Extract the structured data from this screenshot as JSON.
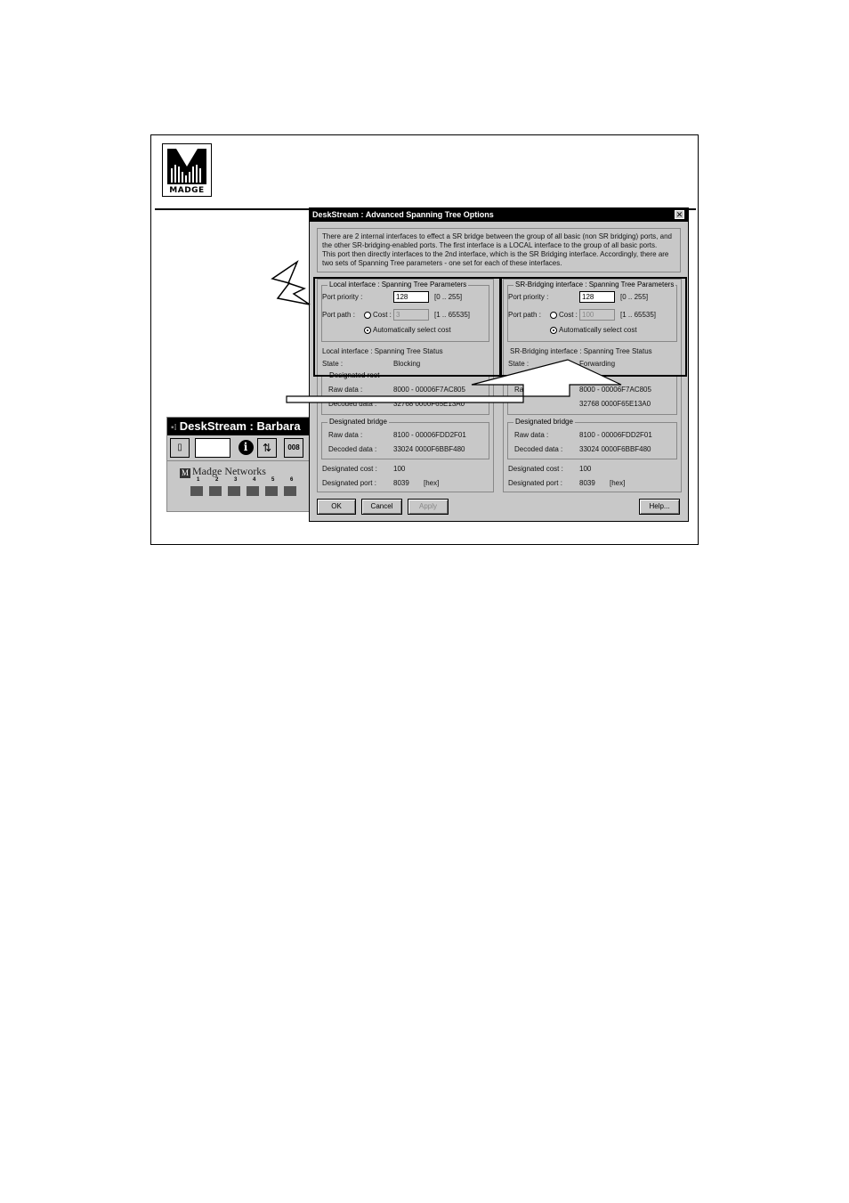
{
  "logo": {
    "text": "MADGE"
  },
  "bg_window": {
    "title": "DeskStream : Barbara",
    "toolbar_label": "008",
    "network_label": "Madge Networks",
    "port_numbers": [
      "1",
      "2",
      "3",
      "4",
      "5",
      "6"
    ]
  },
  "dialog": {
    "title": "DeskStream : Advanced Spanning Tree Options",
    "close_glyph": "✕",
    "intro_lines": [
      "There are 2 internal interfaces to effect a SR bridge between the group of all basic (non SR bridging) ports, and",
      "the other SR-bridging-enabled ports.  The first interface is a LOCAL interface to the group of all basic ports.",
      "This port then directly interfaces to the 2nd interface, which is the SR Bridging interface.  Accordingly, there are",
      "two sets of Spanning Tree parameters - one set for each of these interfaces."
    ],
    "local": {
      "params_title": "Local interface : Spanning Tree Parameters",
      "port_priority_label": "Port priority :",
      "port_priority_value": "128",
      "port_priority_range": "[0 .. 255]",
      "port_path_label": "Port path :",
      "cost_label": "Cost :",
      "cost_value": "3",
      "cost_range": "[1 .. 65535]",
      "auto_label": "Automatically select cost",
      "status_title": "Local interface : Spanning Tree Status",
      "state_label": "State :",
      "state_value": "Blocking",
      "root_title": "Designated root",
      "root_raw_label": "Raw data :",
      "root_raw_value": "8000 - 00006F7AC805",
      "root_decoded_label": "Decoded data :",
      "root_decoded_value": "32768   0000F65E13A0",
      "bridge_title": "Designated bridge",
      "bridge_raw_label": "Raw data :",
      "bridge_raw_value": "8100 - 00006FDD2F01",
      "bridge_decoded_label": "Decoded data :",
      "bridge_decoded_value": "33024   0000F6BBF480",
      "cost_label2": "Designated cost :",
      "cost_value2": "100",
      "port_label2": "Designated port :",
      "port_value2": "8039",
      "port_unit": "[hex]"
    },
    "sr": {
      "params_title": "SR-Bridging interface : Spanning Tree Parameters",
      "port_priority_label": "Port priority :",
      "port_priority_value": "128",
      "port_priority_range": "[0 .. 255]",
      "port_path_label": "Port path :",
      "cost_label": "Cost :",
      "cost_value": "100",
      "cost_range": "[1 .. 65535]",
      "auto_label": "Automatically select cost",
      "status_title": "SR-Bridging interface : Spanning Tree Status",
      "state_label": "State :",
      "state_value": "Forwarding",
      "root_raw_label": "Raw",
      "root_raw_value": "8000 - 00006F7AC805",
      "root_decoded_value": "32768   0000F65E13A0",
      "bridge_title": "Designated bridge",
      "bridge_raw_label": "Raw data :",
      "bridge_raw_value": "8100 - 00006FDD2F01",
      "bridge_decoded_label": "Decoded data :",
      "bridge_decoded_value": "33024   0000F6BBF480",
      "cost_label2": "Designated cost :",
      "cost_value2": "100",
      "port_label2": "Designated port :",
      "port_value2": "8039",
      "port_unit": "[hex]"
    },
    "buttons": {
      "ok": "OK",
      "cancel": "Cancel",
      "apply": "Apply",
      "help": "Help..."
    }
  }
}
